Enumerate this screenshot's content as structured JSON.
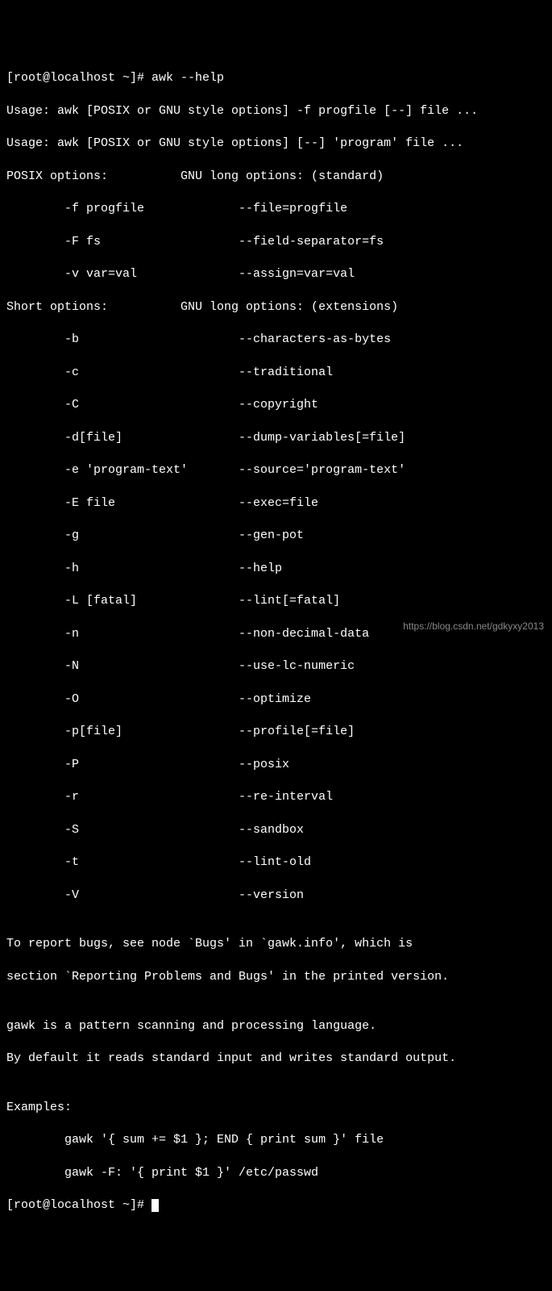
{
  "prompt1": "[root@localhost ~]# ",
  "cmd1": "awk --help",
  "usage1": "Usage: awk [POSIX or GNU style options] -f progfile [--] file ...",
  "usage2": "Usage: awk [POSIX or GNU style options] [--] 'program' file ...",
  "posix_header": "POSIX options:          GNU long options: (standard)",
  "posix_options": [
    "        -f progfile             --file=progfile",
    "        -F fs                   --field-separator=fs",
    "        -v var=val              --assign=var=val"
  ],
  "short_header": "Short options:          GNU long options: (extensions)",
  "short_options": [
    "        -b                      --characters-as-bytes",
    "        -c                      --traditional",
    "        -C                      --copyright",
    "        -d[file]                --dump-variables[=file]",
    "        -e 'program-text'       --source='program-text'",
    "        -E file                 --exec=file",
    "        -g                      --gen-pot",
    "        -h                      --help",
    "        -L [fatal]              --lint[=fatal]",
    "        -n                      --non-decimal-data",
    "        -N                      --use-lc-numeric",
    "        -O                      --optimize",
    "        -p[file]                --profile[=file]",
    "        -P                      --posix",
    "        -r                      --re-interval",
    "        -S                      --sandbox",
    "        -t                      --lint-old",
    "        -V                      --version"
  ],
  "blank": "",
  "bugs1": "To report bugs, see node `Bugs' in `gawk.info', which is",
  "bugs2": "section `Reporting Problems and Bugs' in the printed version.",
  "desc1": "gawk is a pattern scanning and processing language.",
  "desc2": "By default it reads standard input and writes standard output.",
  "examples_header": "Examples:",
  "examples": [
    "        gawk '{ sum += $1 }; END { print sum }' file",
    "        gawk -F: '{ print $1 }' /etc/passwd"
  ],
  "prompt2": "[root@localhost ~]# ",
  "watermark": "https://blog.csdn.net/gdkyxy2013"
}
